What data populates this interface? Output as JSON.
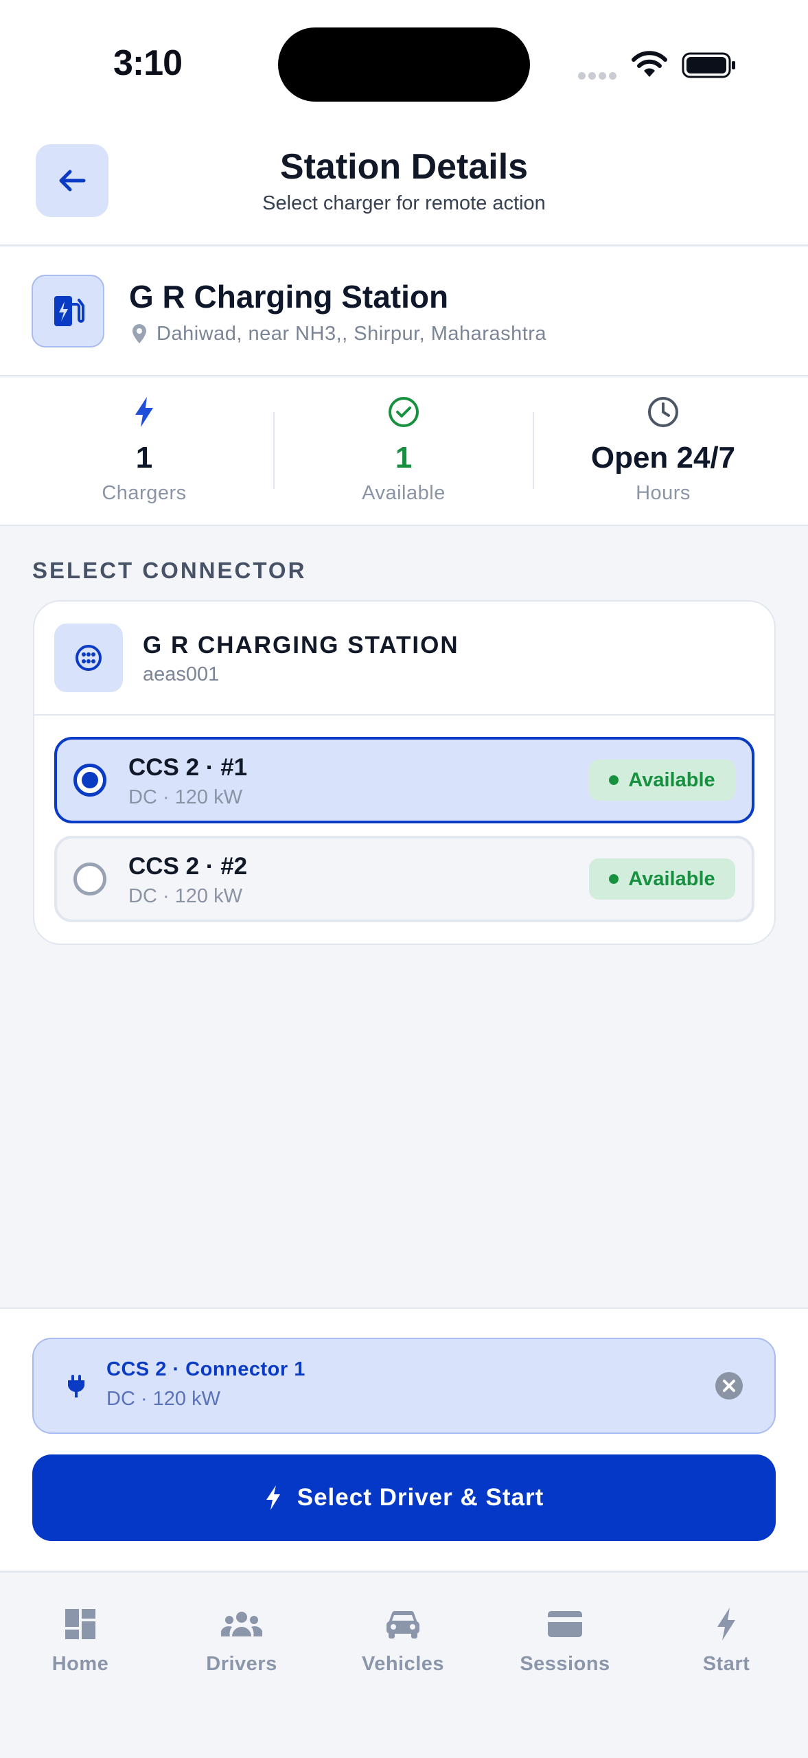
{
  "status_bar": {
    "time": "3:10"
  },
  "header": {
    "title": "Station Details",
    "subtitle": "Select charger for remote action"
  },
  "station": {
    "name": "G R Charging Station",
    "address": "Dahiwad, near NH3,, Shirpur, Maharashtra"
  },
  "stats": [
    {
      "icon": "bolt-icon",
      "value": "1",
      "label": "Chargers",
      "color": "#0f172a"
    },
    {
      "icon": "check-circle-icon",
      "value": "1",
      "label": "Available",
      "color": "#17913f"
    },
    {
      "icon": "clock-icon",
      "value": "Open 24/7",
      "label": "Hours",
      "color": "#0f172a"
    }
  ],
  "section_label": "SELECT CONNECTOR",
  "charger": {
    "name": "G R CHARGING STATION",
    "id": "aeas001",
    "connectors": [
      {
        "title": "CCS 2  ·  #1",
        "sub": "DC  ·  120 kW",
        "status": "Available",
        "selected": true
      },
      {
        "title": "CCS 2  ·  #2",
        "sub": "DC  ·  120 kW",
        "status": "Available",
        "selected": false
      }
    ]
  },
  "selection": {
    "title": "CCS 2  ·  Connector 1",
    "sub": "DC · 120 kW"
  },
  "start_button": {
    "label": "Select Driver & Start"
  },
  "nav": [
    {
      "label": "Home",
      "icon": "dashboard-icon"
    },
    {
      "label": "Drivers",
      "icon": "people-icon"
    },
    {
      "label": "Vehicles",
      "icon": "car-icon"
    },
    {
      "label": "Sessions",
      "icon": "card-icon"
    },
    {
      "label": "Start",
      "icon": "bolt-icon"
    }
  ],
  "colors": {
    "accent": "#0538c6",
    "accent_light": "#d9e2fb",
    "success": "#17913f",
    "muted": "#8b94a5"
  }
}
